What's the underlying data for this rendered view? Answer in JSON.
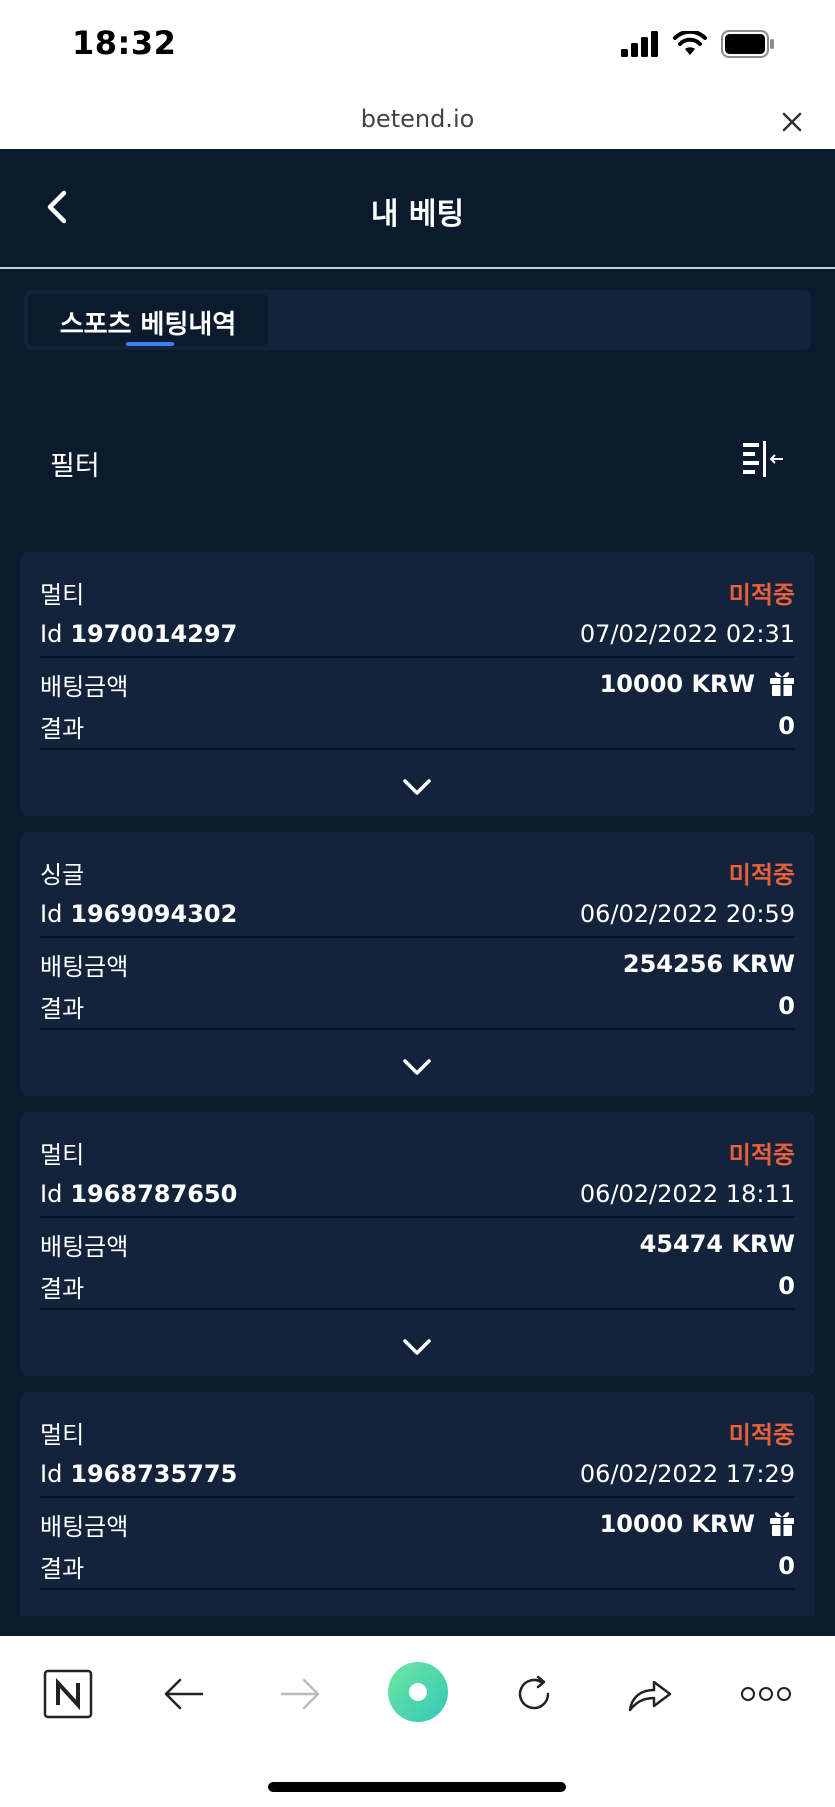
{
  "status_bar": {
    "time": "18:32"
  },
  "browser": {
    "url": "betend.io"
  },
  "header": {
    "title": "내 베팅"
  },
  "tabs": [
    {
      "label": "스포츠 베팅내역",
      "active": true
    }
  ],
  "filter": {
    "label": "필터"
  },
  "bets": [
    {
      "type": "멀티",
      "status": "미적중",
      "id_label": "Id",
      "id": "1970014297",
      "datetime": "07/02/2022 02:31",
      "amount_label": "배팅금액",
      "amount": "10000 KRW",
      "bonus": true,
      "result_label": "결과",
      "result": "0"
    },
    {
      "type": "싱글",
      "status": "미적중",
      "id_label": "Id",
      "id": "1969094302",
      "datetime": "06/02/2022 20:59",
      "amount_label": "배팅금액",
      "amount": "254256 KRW",
      "bonus": false,
      "result_label": "결과",
      "result": "0"
    },
    {
      "type": "멀티",
      "status": "미적중",
      "id_label": "Id",
      "id": "1968787650",
      "datetime": "06/02/2022 18:11",
      "amount_label": "배팅금액",
      "amount": "45474 KRW",
      "bonus": false,
      "result_label": "결과",
      "result": "0"
    },
    {
      "type": "멀티",
      "status": "미적중",
      "id_label": "Id",
      "id": "1968735775",
      "datetime": "06/02/2022 17:29",
      "amount_label": "배팅금액",
      "amount": "10000 KRW",
      "bonus": true,
      "result_label": "결과",
      "result": "0"
    }
  ],
  "colors": {
    "background": "#0c1a2d",
    "card": "#13233b",
    "status_lost": "#e8603c",
    "accent": "#3b82f6"
  },
  "toolbar_icons": [
    "naver-icon",
    "back-arrow-icon",
    "forward-arrow-icon",
    "green-dot-icon",
    "reload-icon",
    "share-icon",
    "more-icon"
  ]
}
